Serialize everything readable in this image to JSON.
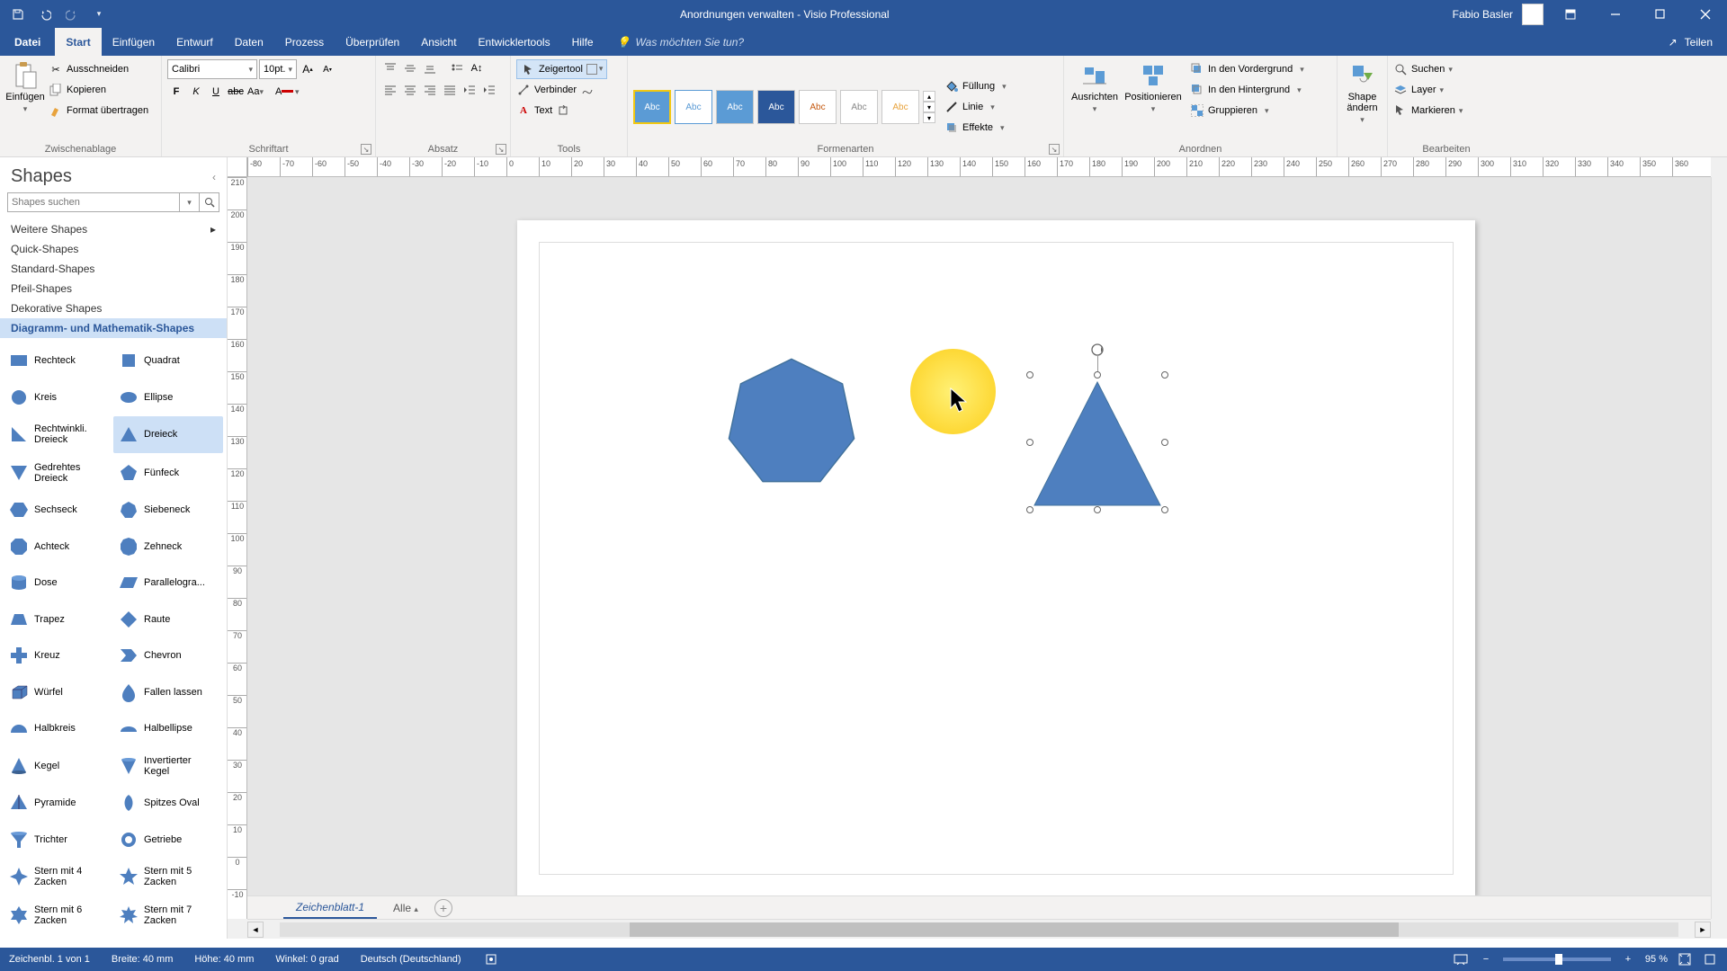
{
  "title": "Anordnungen verwalten  -  Visio Professional",
  "user": "Fabio Basler",
  "ribbon_tabs": [
    "Datei",
    "Start",
    "Einfügen",
    "Entwurf",
    "Daten",
    "Prozess",
    "Überprüfen",
    "Ansicht",
    "Entwicklertools",
    "Hilfe"
  ],
  "active_tab": "Start",
  "tell_me": "Was möchten Sie tun?",
  "share": "Teilen",
  "groups": {
    "clipboard": {
      "label": "Zwischenablage",
      "paste": "Einfügen",
      "cut": "Ausschneiden",
      "copy": "Kopieren",
      "format": "Format übertragen"
    },
    "font": {
      "label": "Schriftart",
      "name": "Calibri",
      "size": "10pt."
    },
    "para": {
      "label": "Absatz"
    },
    "tools": {
      "label": "Tools",
      "pointer": "Zeigertool",
      "connector": "Verbinder",
      "text": "Text"
    },
    "styles": {
      "label": "Formenarten",
      "abc": "Abc",
      "fill": "Füllung",
      "line": "Linie",
      "effects": "Effekte"
    },
    "arrange": {
      "label": "Anordnen",
      "align": "Ausrichten",
      "position": "Positionieren",
      "front": "In den Vordergrund",
      "back": "In den Hintergrund",
      "group": "Gruppieren"
    },
    "change": {
      "label": "",
      "shape": "Shape ändern"
    },
    "edit": {
      "label": "Bearbeiten",
      "find": "Suchen",
      "layer": "Layer",
      "select": "Markieren"
    }
  },
  "shapes_pane": {
    "title": "Shapes",
    "search_placeholder": "Shapes suchen",
    "more": "Weitere Shapes",
    "categories": [
      "Quick-Shapes",
      "Standard-Shapes",
      "Pfeil-Shapes",
      "Dekorative Shapes",
      "Diagramm- und Mathematik-Shapes"
    ],
    "active_category": "Diagramm- und Mathematik-Shapes",
    "shapes": [
      [
        "Rechteck",
        "Quadrat"
      ],
      [
        "Kreis",
        "Ellipse"
      ],
      [
        "Rechtwinkli. Dreieck",
        "Dreieck"
      ],
      [
        "Gedrehtes Dreieck",
        "Fünfeck"
      ],
      [
        "Sechseck",
        "Siebeneck"
      ],
      [
        "Achteck",
        "Zehneck"
      ],
      [
        "Dose",
        "Parallelogra..."
      ],
      [
        "Trapez",
        "Raute"
      ],
      [
        "Kreuz",
        "Chevron"
      ],
      [
        "Würfel",
        "Fallen lassen"
      ],
      [
        "Halbkreis",
        "Halbellipse"
      ],
      [
        "Kegel",
        "Invertierter Kegel"
      ],
      [
        "Pyramide",
        "Spitzes Oval"
      ],
      [
        "Trichter",
        "Getriebe"
      ],
      [
        "Stern mit 4 Zacken",
        "Stern mit 5 Zacken"
      ],
      [
        "Stern mit 6 Zacken",
        "Stern mit 7 Zacken"
      ]
    ],
    "selected_shape": "Dreieck"
  },
  "h_ruler_ticks": [
    "-80",
    "-70",
    "-60",
    "-50",
    "-40",
    "-30",
    "-20",
    "-10",
    "0",
    "10",
    "20",
    "30",
    "40",
    "50",
    "60",
    "70",
    "80",
    "90",
    "100",
    "110",
    "120",
    "130",
    "140",
    "150",
    "160",
    "170",
    "180",
    "190",
    "200",
    "210",
    "220",
    "230",
    "240",
    "250",
    "260",
    "270",
    "280",
    "290",
    "300",
    "310",
    "320",
    "330",
    "340",
    "350",
    "360"
  ],
  "v_ruler_ticks": [
    "210",
    "200",
    "190",
    "180",
    "170",
    "160",
    "150",
    "140",
    "130",
    "120",
    "110",
    "100",
    "90",
    "80",
    "70",
    "60",
    "50",
    "40",
    "30",
    "20",
    "10",
    "0",
    "-10"
  ],
  "sheet_tab": "Zeichenblatt-1",
  "sheet_all": "Alle",
  "status": {
    "page": "Zeichenbl. 1 von 1",
    "width": "Breite: 40 mm",
    "height": "Höhe: 40 mm",
    "angle": "Winkel: 0 grad",
    "lang": "Deutsch (Deutschland)",
    "zoom": "95 %"
  }
}
